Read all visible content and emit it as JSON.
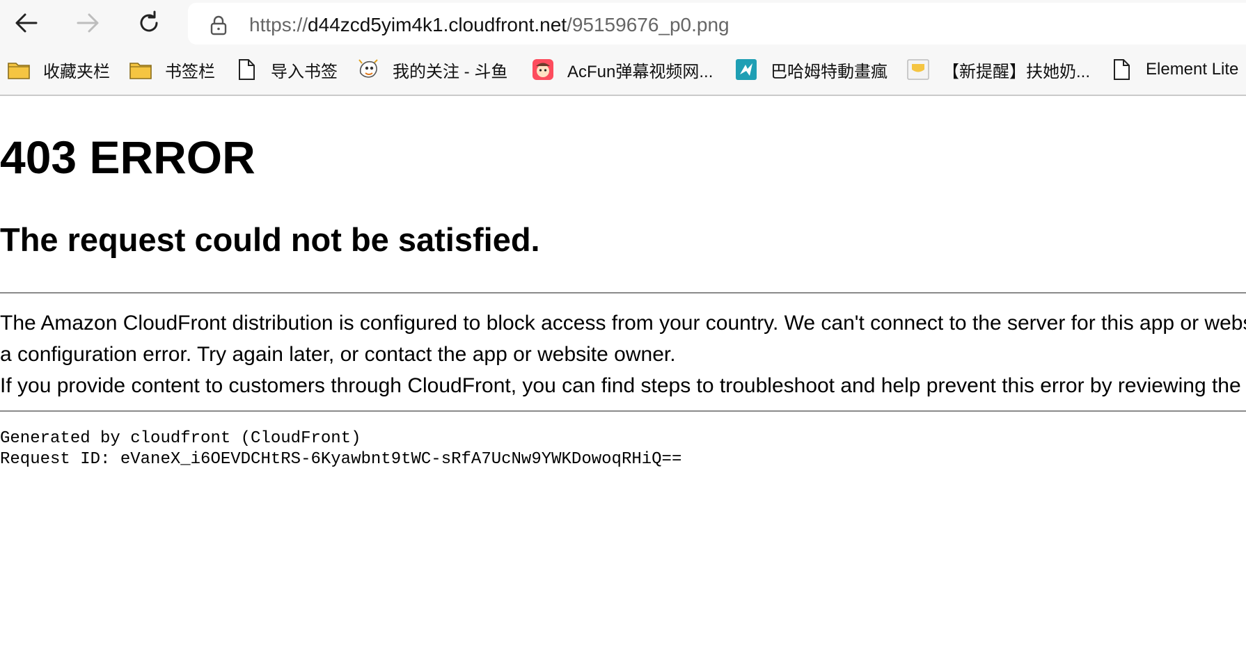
{
  "browser": {
    "address_bar": {
      "url_scheme": "https://",
      "url_host": "d44zcd5yim4k1.cloudfront.net",
      "url_path": "/95159676_p0.png"
    },
    "bookmarks": [
      {
        "label": "收藏夹栏",
        "icon": "folder-icon"
      },
      {
        "label": "书签栏",
        "icon": "folder-icon"
      },
      {
        "label": "导入书签",
        "icon": "page-icon"
      },
      {
        "label": "我的关注 - 斗鱼",
        "icon": "douyu-icon"
      },
      {
        "label": "AcFun弹幕视频网...",
        "icon": "acfun-icon"
      },
      {
        "label": "巴哈姆特動畫瘋",
        "icon": "bahamut-icon"
      },
      {
        "label": "【新提醒】扶她奶...",
        "icon": "site-icon"
      },
      {
        "label": "Element Lite",
        "icon": "page-icon"
      }
    ],
    "colors": {
      "chrome_bg": "#f7f7f7",
      "folder_yellow": "#f5c542"
    }
  },
  "page": {
    "title": "403 ERROR",
    "subtitle": "The request could not be satisfied.",
    "message_line1": "The Amazon CloudFront distribution is configured to block access from your country. We can't connect to the server for this app or website at this time. There might be too much traffic or",
    "message_line2": "a configuration error. Try again later, or contact the app or website owner.",
    "message_line3": "If you provide content to customers through CloudFront, you can find steps to troubleshoot and help prevent this error by reviewing the CloudFront documentation.",
    "generated_by": "Generated by cloudfront (CloudFront)",
    "request_id": "Request ID: eVaneX_i6OEVDCHtRS-6Kyawbnt9tWC-sRfA7UcNw9YWKDowoqRHiQ=="
  }
}
